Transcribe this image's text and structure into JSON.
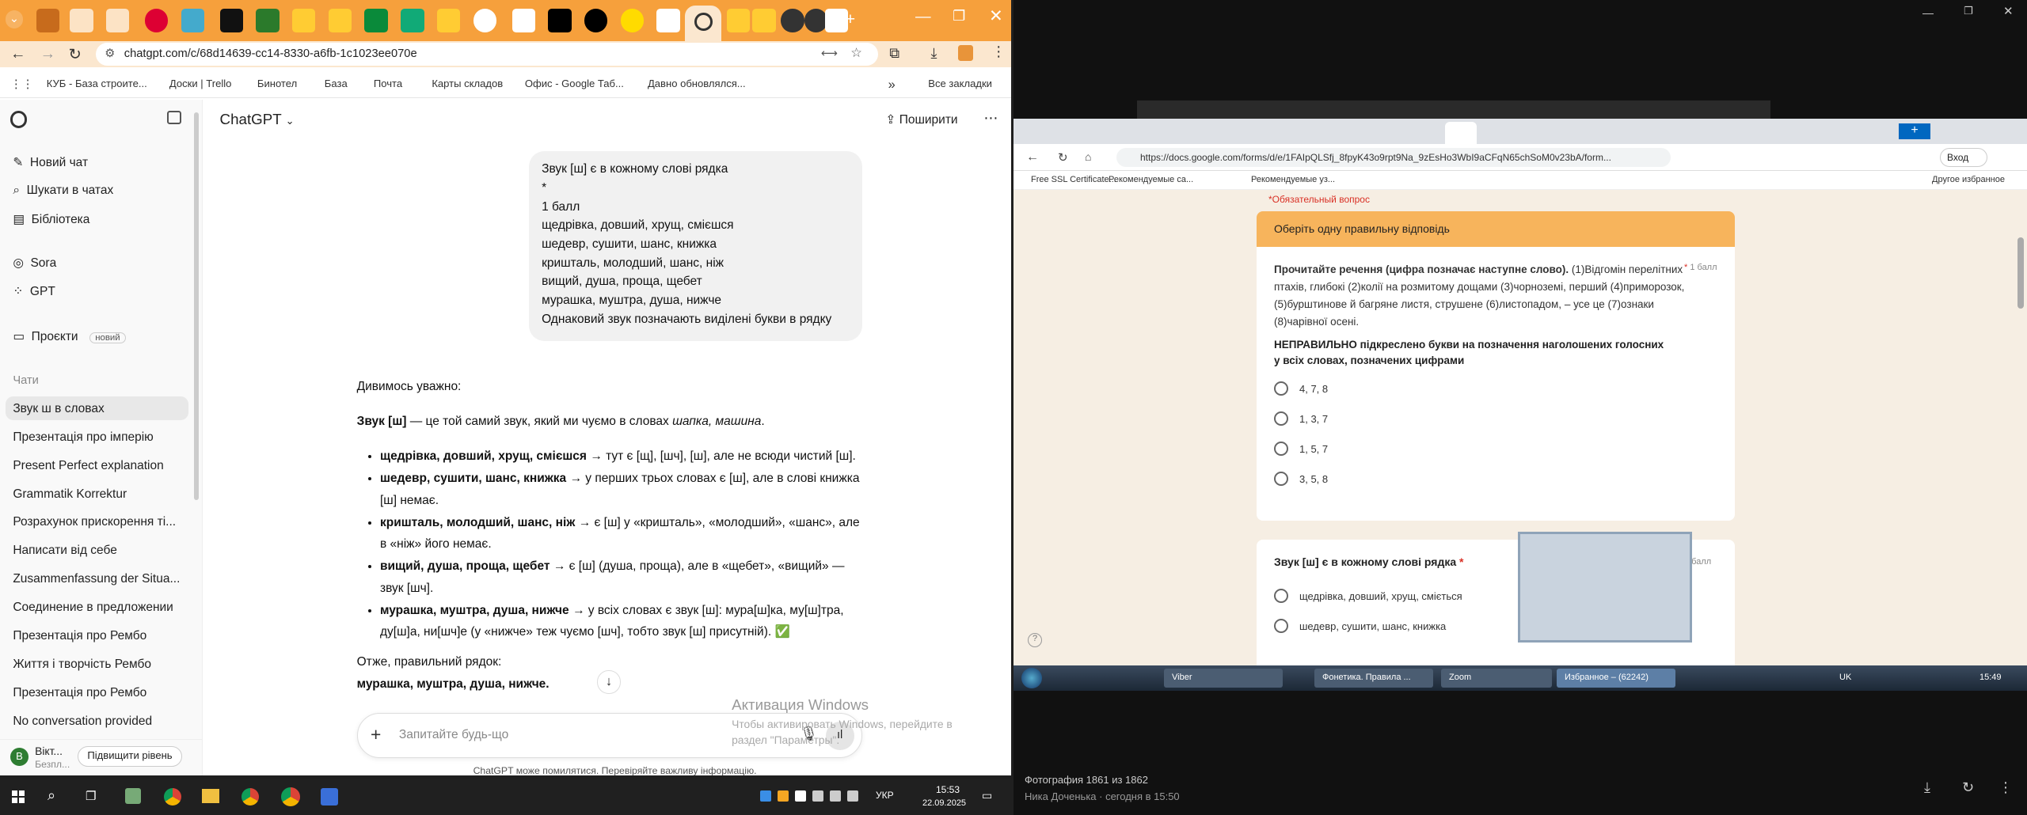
{
  "left_browser": {
    "tab_strip": {
      "color": "#f6a03c"
    },
    "address": "chatgpt.com/c/68d14639-cc14-8330-a6fb-1c1023ee070e",
    "bookmarks": [
      "КУБ - База строите...",
      "Доски | Trello",
      "Бинотел",
      "База",
      "Почта",
      "Карты складов",
      "Офис - Google Таб...",
      "Давно обновлялся..."
    ],
    "bookmarks_all": "Все закладки",
    "sidebar": {
      "new_chat": "Новий чат",
      "search": "Шукати в чатах",
      "library": "Бібліотека",
      "sora": "Sora",
      "gpt": "GPT",
      "projects": "Проєкти",
      "projects_badge": "новий",
      "chats_header": "Чати",
      "chats": [
        "Звук ш в словах",
        "Презентація про імперію",
        "Present Perfect explanation",
        "Grammatik Korrektur",
        "Розрахунок прискорення ті...",
        "Написати від себе",
        "Zusammenfassung der Situa...",
        "Соединение в предложении",
        "Презентація про Рембо",
        "Життя і творчість Рембо",
        "Презентація про Рембо",
        "No conversation provided"
      ],
      "user_name": "Вікт...",
      "user_plan": "Безпл...",
      "upgrade": "Підвищити рівень",
      "avatar_letter": "В"
    },
    "header": {
      "model": "ChatGPT",
      "share": "Поширити"
    },
    "user_message": "Звук [ш] є в кожному слові рядка\n*\n1 балл\nщедрівка, довший, хрущ, смієшся\nшедевр, сушити, шанс, книжка\nкришталь, молодший, шанс, ніж\nвищий, душа, проща, щебет\nмурашка, муштра, душа, нижче\nОднаковий звук позначають виділені   букви в рядку",
    "response": {
      "intro": "Дивимось уважно:",
      "p1_bold": "Звук [ш]",
      "p1_rest": " — це той самий звук, який ми чуємо в словах ",
      "p1_em": "шапка, машина",
      "items": [
        {
          "b": "щедрівка, довший, хрущ, смієшся",
          "t": " → тут є [щ], [шч], [ш], але не всюди чистий [ш]."
        },
        {
          "b": "шедевр, сушити, шанс, книжка",
          "t": " → у перших трьох словах є [ш], але в слові книжка [ш] немає."
        },
        {
          "b": "кришталь, молодший, шанс, ніж",
          "t": " → є [ш] у «кришталь», «молодший», «шанс», але в «ніж» його немає."
        },
        {
          "b": "вищий, душа, проща, щебет",
          "t": " → є [ш] (душа, проща), але в «щебет», «вищий» — звук [шч]."
        },
        {
          "b": "мурашка, муштра, душа, нижче",
          "t": " → у всіх словах є звук [ш]: мура[ш]ка, му[ш]тра, ду[ш]а, ни[шч]е (у «нижче» теж чуємо [шч], тобто звук [ш] присутній). ✅"
        }
      ],
      "conclusion": "Отже, правильний рядок:",
      "answer": "мурашка, муштра, душа, нижче."
    },
    "input_placeholder": "Запитайте будь-що",
    "disclaimer": "ChatGPT може помилятися. Перевіряйте важливу інформацію.",
    "activation_title": "Активация Windows",
    "activation_sub": "Чтобы активировать Windows, перейдите в раздел \"Параметры\".",
    "taskbar": {
      "lang": "УКР",
      "time": "15:53",
      "date": "22.09.2025"
    }
  },
  "photo_viewer": {
    "inner_address": "https://docs.google.com/forms/d/e/1FAIpQLSfj_8fpyK43o9rpt9Na_9zEsHo3WbI9aCFqN65chSoM0v23bA/form...",
    "inner_bookmarks": [
      "Free SSL Certificate...",
      "Рекомендуемые са...",
      "Рекомендуемые уз..."
    ],
    "inner_bookmarks_other": "Другое избранное",
    "inner_signin": "Вход",
    "required_note": "*Обязательный вопрос",
    "section_header": "Оберіть одну правильну відповідь",
    "q1": {
      "text_bold": "Прочитайте речення (цифра позначає наступне слово).",
      "text": " (1)Відгомін перелітних птахів, глибокі (2)колії на розмитому дощами (3)чорноземі, перший (4)приморозок, (5)бурштинове й багряне листя, струшене (6)листопадом, – усе це (7)ознаки (8)чарівної осені.",
      "points": "1 балл",
      "prompt": "НЕПРАВИЛЬНО підкреслено букви на позначення наголошених голосних у всіх словах, позначених цифрами",
      "options": [
        "4, 7, 8",
        "1, 3, 7",
        "1, 5, 7",
        "3, 5, 8"
      ]
    },
    "q2": {
      "title": "Звук [ш] є в кожному слові рядка",
      "points": "1 балл",
      "options": [
        "щедрівка, довший, хрущ, сміється",
        "шедевр, сушити, шанс, книжка"
      ]
    },
    "inner_taskbar": {
      "items": [
        "Viber",
        "Фонетика. Правила ...",
        "Zoom",
        "Избранное – (62242)"
      ],
      "lang": "UK",
      "time": "15:49"
    },
    "caption_line1": "Фотография 1861 из 1862",
    "caption_line2": "Ника Доченька · сегодня в 15:50"
  }
}
